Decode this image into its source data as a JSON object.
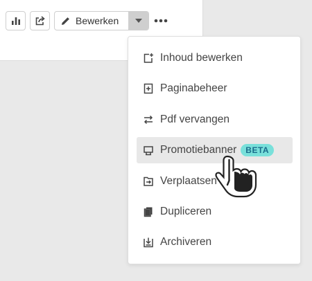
{
  "toolbar": {
    "edit_label": "Bewerken"
  },
  "icons": {
    "stats": "bar-chart-icon",
    "share": "share-icon",
    "edit": "pencil-icon",
    "dropdown": "caret-down-icon",
    "more": "more-dots-icon",
    "cursor": "hand-pointer-cursor"
  },
  "menu": {
    "items": [
      {
        "label": "Inhoud bewerken",
        "icon": "edit-content-icon"
      },
      {
        "label": "Paginabeheer",
        "icon": "page-add-icon"
      },
      {
        "label": "Pdf vervangen",
        "icon": "swap-arrows-icon"
      },
      {
        "label": "Promotiebanner",
        "icon": "banner-icon",
        "badge": "BETA",
        "hovered": true
      },
      {
        "label": "Verplaatsen",
        "icon": "move-icon"
      },
      {
        "label": "Dupliceren",
        "icon": "copy-icon"
      },
      {
        "label": "Archiveren",
        "icon": "archive-icon"
      }
    ]
  },
  "colors": {
    "background": "#e9e9e9",
    "panel": "#ffffff",
    "badge_bg": "#79e0da",
    "badge_text": "#1a6c8c",
    "hover_row": "#e8e8e8",
    "text": "#444444"
  }
}
